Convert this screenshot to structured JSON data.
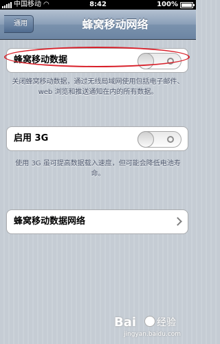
{
  "status_bar": {
    "carrier": "中国移动",
    "time": "8:42",
    "battery": "100%"
  },
  "nav": {
    "back_label": "通用",
    "title": "蜂窝移动网络"
  },
  "cellular_data": {
    "label": "蜂窝移动数据",
    "toggle_state": "off",
    "footer": "关闭蜂窝移动数据，通过无线局域网使用包括电子邮件、web 浏览和推送通知在内的所有数据。"
  },
  "enable_3g": {
    "label": "启用 3G",
    "toggle_state": "off",
    "footer": "使用 3G 虽可提高数据载入速度，但可能会降低电池寿命。"
  },
  "cellular_network": {
    "label": "蜂窝移动数据网络"
  },
  "watermark": {
    "logo": "Bai",
    "brand": "经验",
    "url": "jingyan.baidu.com"
  },
  "colors": {
    "highlight": "#d8202a",
    "nav_bar": "#7a92ad",
    "background": "#c5ccd4"
  }
}
